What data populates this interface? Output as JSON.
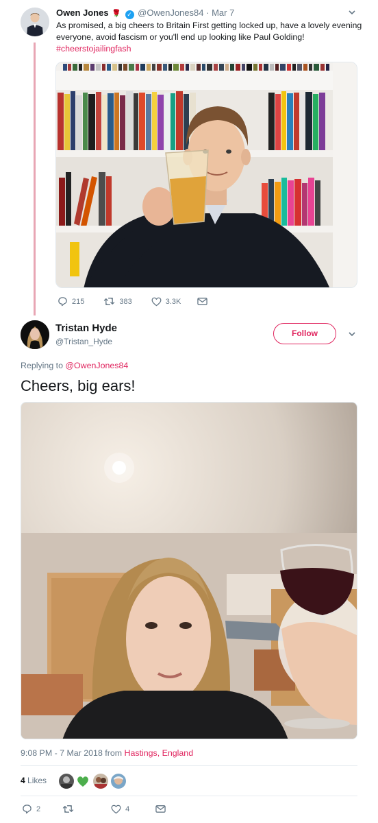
{
  "tweet1": {
    "author_name": "Owen Jones",
    "name_emoji": "🌹",
    "verified_mark": "✓",
    "handle": "@OwenJones84",
    "separator": "·",
    "date": "Mar 7",
    "text": "As promised, a big cheers to Britain First getting locked up, have a lovely evening everyone, avoid fascism or you'll end up looking like Paul Golding!",
    "hashtag": "#cheerstojailingfash",
    "replies": "215",
    "retweets": "383",
    "likes": "3.3K",
    "icons": [
      "reply-icon",
      "retweet-icon",
      "like-icon",
      "message-icon"
    ]
  },
  "tweet2": {
    "author_name": "Tristan Hyde",
    "handle": "@Tristan_Hyde",
    "follow_label": "Follow",
    "replying_prefix": "Replying to",
    "replying_to": "@OwenJones84",
    "text": "Cheers, big ears!",
    "timestamp": "9:08 PM - 7 Mar 2018 from",
    "location": "Hastings, England",
    "likes_count": "4",
    "likes_label": "Likes",
    "replies": "2",
    "retweets": "",
    "likes": "4"
  },
  "colors": {
    "accent": "#e0245e",
    "thread_line": "#e8a6b4",
    "muted": "#657786",
    "verified": "#1da1f2"
  }
}
